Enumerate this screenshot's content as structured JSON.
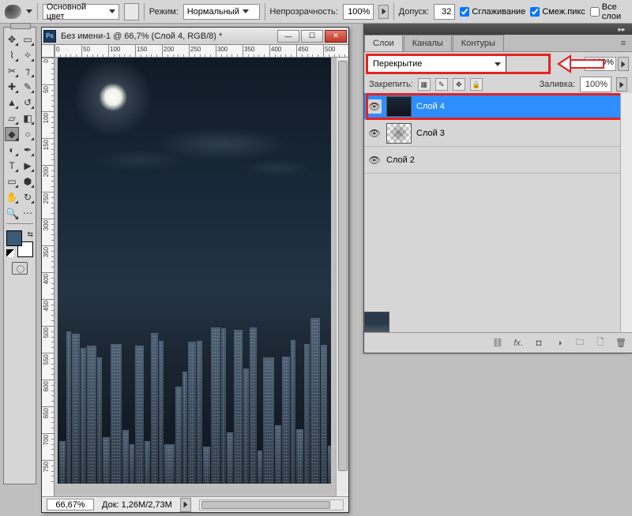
{
  "optionBar": {
    "foregroundLabel": "Основной цвет",
    "modeLabel": "Режим:",
    "modeValue": "Нормальный",
    "opacityLabel": "Непрозрачность:",
    "opacityValue": "100%",
    "toleranceLabel": "Допуск:",
    "toleranceValue": "32",
    "antialiasLabel": "Сглаживание",
    "contiguousLabel": "Смеж.пикс",
    "allLayersLabel": "Все слои"
  },
  "document": {
    "title": "Без имени-1 @ 66,7% (Слой 4, RGB/8) *",
    "zoom": "66,67%",
    "docSizeLabel": "Док:",
    "docSize": "1,26M/2,73M",
    "rulerH": [
      "0",
      "50",
      "100",
      "150",
      "200",
      "250",
      "300",
      "350",
      "400",
      "450",
      "500"
    ],
    "rulerV": [
      "0",
      "50",
      "100",
      "150",
      "200",
      "250",
      "300",
      "350",
      "400",
      "450",
      "500",
      "550",
      "600",
      "650",
      "700",
      "750"
    ]
  },
  "panel": {
    "tabs": {
      "layers": "Слои",
      "channels": "Каналы",
      "paths": "Контуры"
    },
    "blendMode": "Перекрытие",
    "opacityValue": "100%",
    "lockLabel": "Закрепить:",
    "fillLabel": "Заливка:",
    "fillValue": "100%",
    "layers": [
      {
        "name": "Слой 4"
      },
      {
        "name": "Слой 3"
      },
      {
        "name": "Слой 2"
      }
    ]
  }
}
